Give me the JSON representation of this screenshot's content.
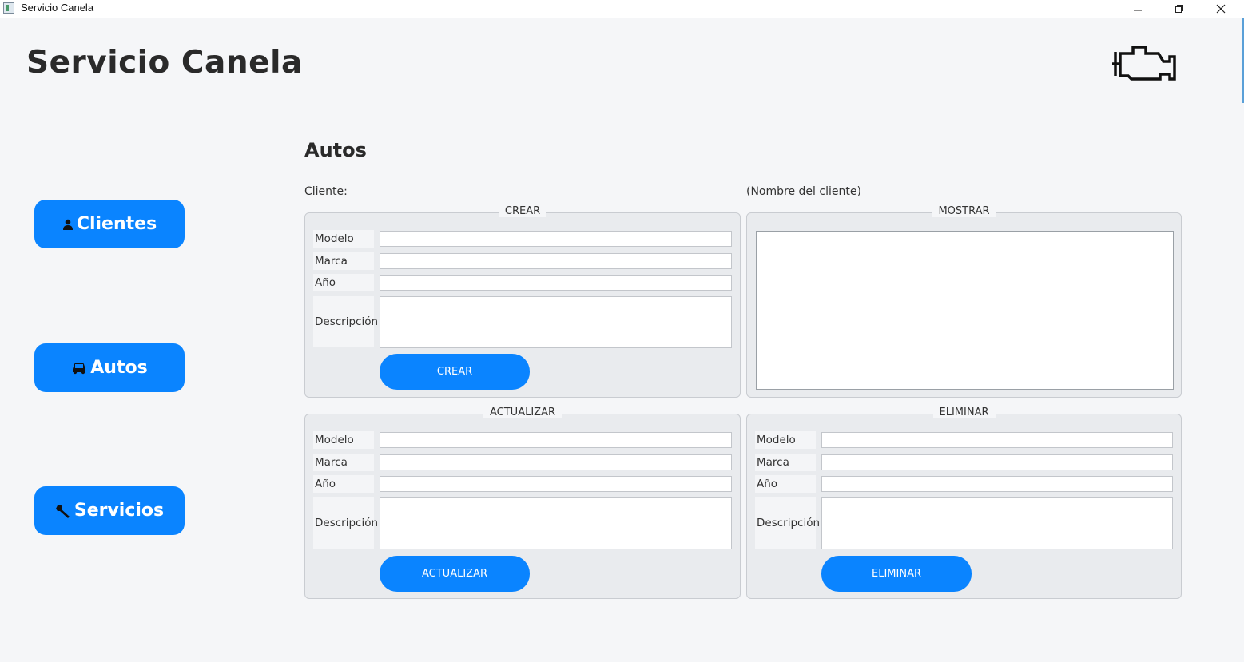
{
  "window": {
    "title": "Servicio Canela",
    "controls": [
      "minimize",
      "restore",
      "close"
    ]
  },
  "header": {
    "title": "Servicio Canela",
    "logo_icon": "engine-icon"
  },
  "sidebar": {
    "items": [
      {
        "label": "Clientes",
        "icon": "person-icon"
      },
      {
        "label": "Autos",
        "icon": "car-icon"
      },
      {
        "label": "Servicios",
        "icon": "wrench-icon"
      }
    ]
  },
  "main": {
    "title": "Autos",
    "cliente_label": "Cliente:",
    "cliente_value": "(Nombre del cliente)",
    "crear": {
      "title": "CREAR",
      "labels": {
        "modelo": "Modelo",
        "marca": "Marca",
        "anio": "Año",
        "descripcion": "Descripción"
      },
      "values": {
        "modelo": "",
        "marca": "",
        "anio": "",
        "descripcion": ""
      },
      "button": "CREAR"
    },
    "mostrar": {
      "title": "MOSTRAR",
      "content": ""
    },
    "actualizar": {
      "title": "ACTUALIZAR",
      "labels": {
        "modelo": "Modelo",
        "marca": "Marca",
        "anio": "Año",
        "descripcion": "Descripción"
      },
      "values": {
        "modelo": "",
        "marca": "",
        "anio": "",
        "descripcion": ""
      },
      "button": "ACTUALIZAR"
    },
    "eliminar": {
      "title": "ELIMINAR",
      "labels": {
        "modelo": "Modelo",
        "marca": "Marca",
        "anio": "Año",
        "descripcion": "Descripción"
      },
      "values": {
        "modelo": "",
        "marca": "",
        "anio": "",
        "descripcion": ""
      },
      "button": "ELIMINAR"
    }
  },
  "colors": {
    "accent": "#0a84ff",
    "background": "#f5f6f8",
    "group_background": "#e9ebee"
  }
}
